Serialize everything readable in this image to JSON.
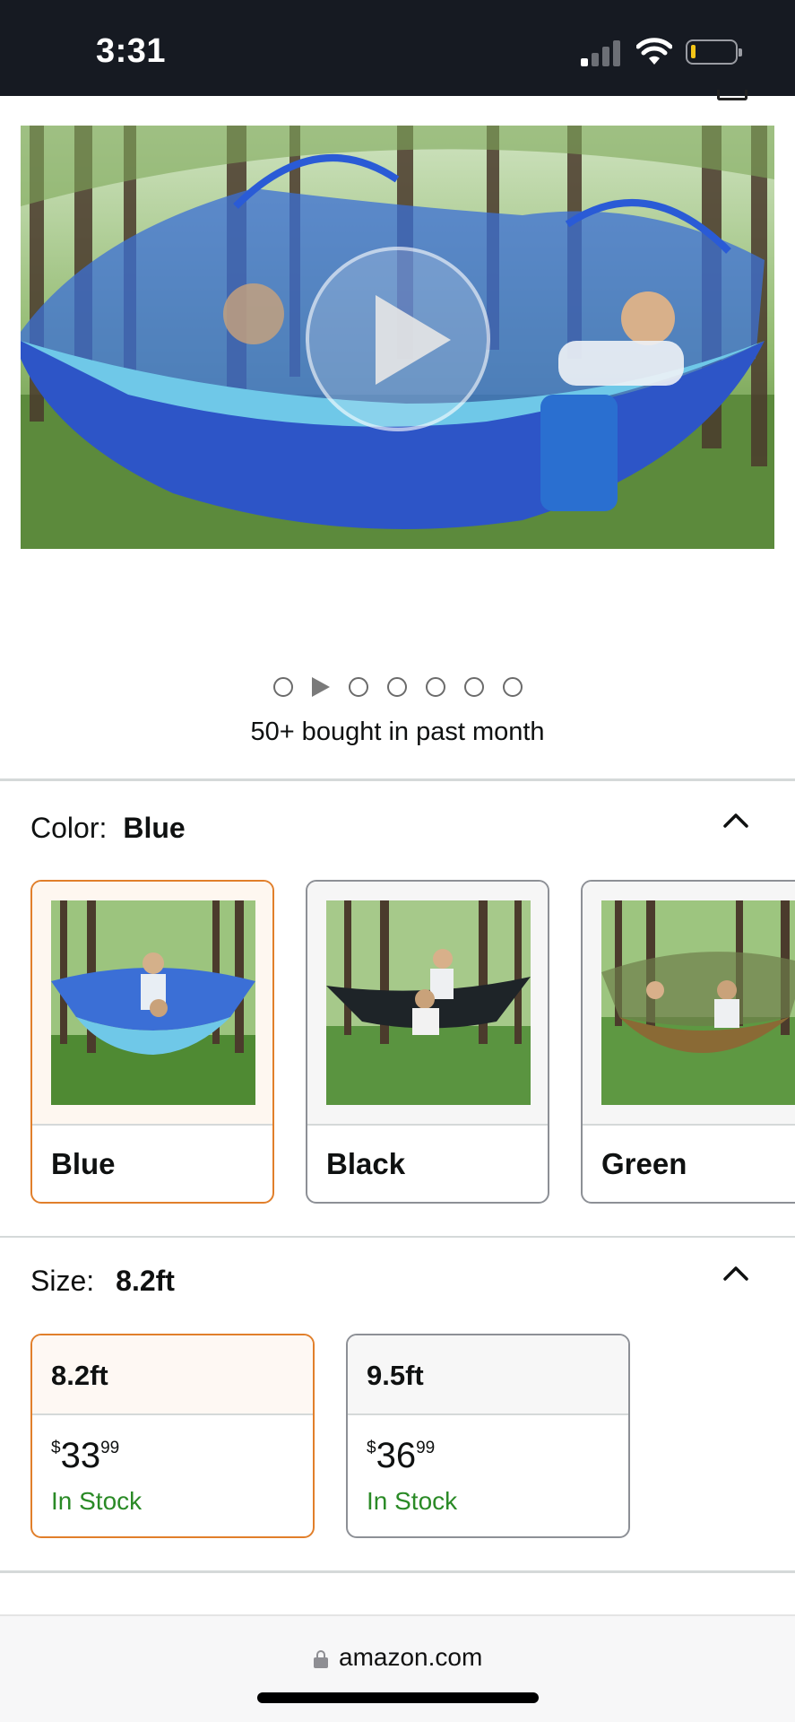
{
  "status_bar": {
    "time": "3:31"
  },
  "gallery": {
    "dot_count": 7,
    "active_index": 1,
    "bought_text": "50+ bought in past month"
  },
  "color": {
    "label": "Color:",
    "value": "Blue",
    "options": [
      {
        "name": "Blue",
        "selected": true
      },
      {
        "name": "Black",
        "selected": false
      },
      {
        "name": "Green",
        "selected": false
      }
    ]
  },
  "size": {
    "label": "Size:",
    "value": "8.2ft",
    "options": [
      {
        "name": "8.2ft",
        "currency": "$",
        "whole": "33",
        "fraction": "99",
        "stock": "In Stock",
        "selected": true
      },
      {
        "name": "9.5ft",
        "currency": "$",
        "whole": "36",
        "fraction": "99",
        "stock": "In Stock",
        "selected": false
      }
    ]
  },
  "browser": {
    "url": "amazon.com"
  },
  "colors": {
    "selected_border": "#e17f2b",
    "stock_green": "#2a8a26",
    "status_bar_bg": "#161a22"
  },
  "icons": [
    "signal-icon",
    "wifi-icon",
    "battery-icon",
    "play-icon",
    "chevron-up-icon",
    "lock-icon"
  ]
}
